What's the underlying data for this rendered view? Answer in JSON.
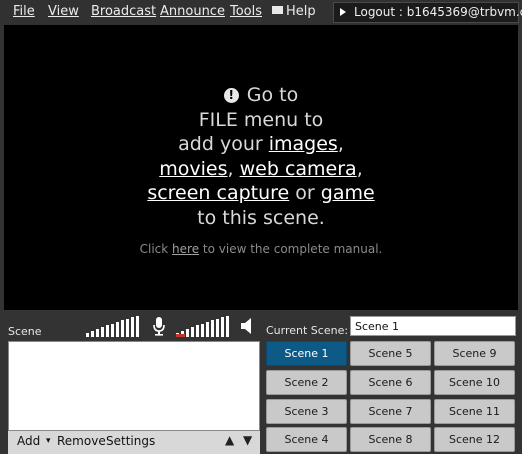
{
  "menu": {
    "file": "File",
    "view": "View",
    "broadcast": "Broadcast",
    "announce": "Announce",
    "tools": "Tools",
    "help": "Help"
  },
  "logout": "Logout : b1645369@trbvm.com",
  "preview": {
    "line1": "Go to",
    "line2": "FILE menu to",
    "line3_pre": "add your ",
    "images": "images",
    "comma1": ",",
    "movies": "movies",
    "comma2": ", ",
    "web_camera": "web camera",
    "comma3": ",",
    "screen_capture": "screen capture",
    "or": " or ",
    "game": "game",
    "line6": "to this scene.",
    "manual_pre": "Click ",
    "manual_link": "here",
    "manual_post": " to view the complete manual."
  },
  "scene_panel": {
    "label": "Scene",
    "add": "Add",
    "dropdown_arrow": "▾",
    "remove": "Remove",
    "settings": "Settings",
    "up": "▲",
    "down": "▼"
  },
  "current_scene": {
    "label": "Current Scene:",
    "value": "Scene 1"
  },
  "scenes": [
    "Scene 1",
    "Scene 2",
    "Scene 3",
    "Scene 4",
    "Scene 5",
    "Scene 6",
    "Scene 7",
    "Scene 8",
    "Scene 9",
    "Scene 10",
    "Scene 11",
    "Scene 12"
  ],
  "active_scene": "Scene 1",
  "colors": {
    "active": "#0e5a86",
    "preview_bg": "#000000",
    "panel_bg": "#333333"
  }
}
